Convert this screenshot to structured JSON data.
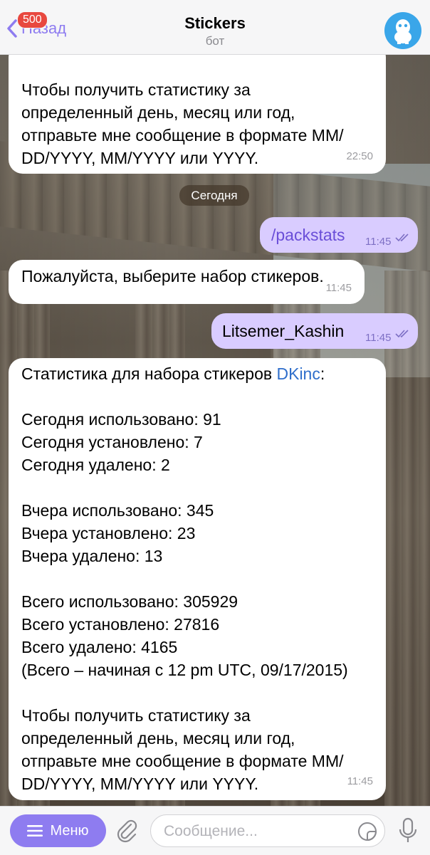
{
  "header": {
    "back_label": "Назад",
    "unread_badge": "500",
    "title": "Stickers",
    "subtitle": "бот",
    "avatar_icon": "bot-avatar-icon"
  },
  "date_separator": "Сегодня",
  "messages": [
    {
      "direction": "in",
      "text": "Чтобы получить статистику за\nопределенный день, месяц или год,\nотправьте мне сообщение в формате MM/\nDD/YYYY, MM/YYYY или YYYY.",
      "time": "22:50"
    },
    {
      "direction": "out",
      "text": "/packstats",
      "time": "11:45"
    },
    {
      "direction": "in",
      "text": "Пожалуйста, выберите набор стикеров.",
      "time": "11:45"
    },
    {
      "direction": "out",
      "text": "Litsemer_Kashin",
      "time": "11:45"
    },
    {
      "direction": "in",
      "text_before_link": "Статистика для набора стикеров ",
      "link": "DKinc",
      "text_after_link": ":",
      "body": "\nСегодня использовано: 91\nСегодня установлено: 7\nСегодня удалено: 2\n\nВчера использовано: 345\nВчера установлено: 23\nВчера удалено: 13\n\nВсего использовано: 305929\nВсего установлено: 27816\nВсего удалено: 4165\n(Всего – начиная с 12 pm UTC, 09/17/2015)\n\nЧтобы получить статистику за\nопределенный день, месяц или год,\nотправьте мне сообщение в формате MM/\nDD/YYYY, MM/YYYY или YYYY.",
      "time": "11:45"
    }
  ],
  "bottom_bar": {
    "menu_label": "Меню",
    "input_placeholder": "Сообщение..."
  },
  "colors": {
    "accent": "#8e7cf0",
    "outgoing_bubble": "#d9ccff",
    "badge": "#e8483f",
    "link": "#2f6ecb"
  }
}
